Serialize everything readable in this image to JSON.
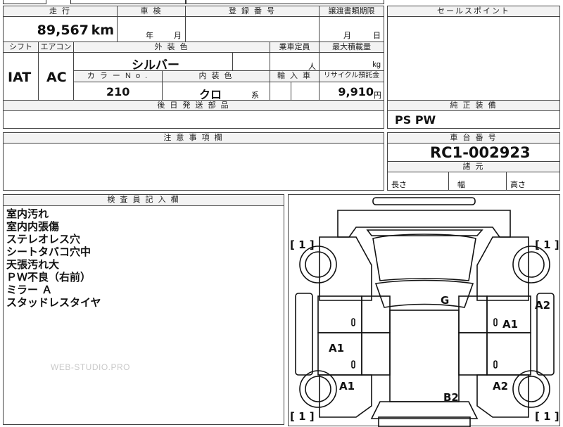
{
  "headers": {
    "mileage": "走 行",
    "inspection": "車 検",
    "registration": "登 録 番 号",
    "transfer_deadline": "譲渡書類期限",
    "sales_point": "セールスポイント",
    "shift": "シフト",
    "aircon": "エアコン",
    "exterior_color": "外 装 色",
    "seating": "乗車定員",
    "max_load": "最大積載量",
    "color_no": "カ ラ ー N o .",
    "interior_color": "内 装 色",
    "import": "輸 入 車",
    "recycle_fee": "リサイクル預託金",
    "parts_later": "後 日 発 送 部 品",
    "standard_equipment": "純 正 装 備",
    "notes": "注 意 事 項 欄",
    "chassis_number": "車 台 番 号",
    "dimensions": "諸 元",
    "inspector_notes": "検 査 員 記 入 欄"
  },
  "values": {
    "mileage": "89,567",
    "mileage_unit": "km",
    "year_unit": "年",
    "month_unit": "月",
    "deadline_month": "月",
    "deadline_day": "日",
    "shift": "IAT",
    "aircon": "AC",
    "exterior_color": "シルバー",
    "seating_unit": "人",
    "load_unit": "kg",
    "color_no": "210",
    "interior_color": "クロ",
    "interior_suffix": "系",
    "recycle_fee": "9,910",
    "recycle_unit": "円",
    "standard_equipment": "PS PW",
    "chassis_number": "RC1-002923",
    "dim_length": "長さ",
    "dim_width": "幅",
    "dim_height": "高さ"
  },
  "inspector_notes": [
    "室内汚れ",
    "室内内張傷",
    "ステレオレス穴",
    "シートタバコ穴中",
    "天張汚れ大",
    "ＰＷ不良（右前）",
    "ミラー Ａ",
    "スタッドレスタイヤ"
  ],
  "diagram": {
    "tire_marks": [
      "[ 1 ]",
      "[ 1 ]",
      "[ 1 ]",
      "[ 1 ]"
    ],
    "damage_codes": {
      "g": "G",
      "a2_right": "A2",
      "a1_right": "A1",
      "a1_left_mid": "A1",
      "a1_left_low": "A1",
      "a2_right_low": "A2",
      "b2_rear": "B2"
    }
  },
  "watermark": "WEB-STUDIO.PRO"
}
